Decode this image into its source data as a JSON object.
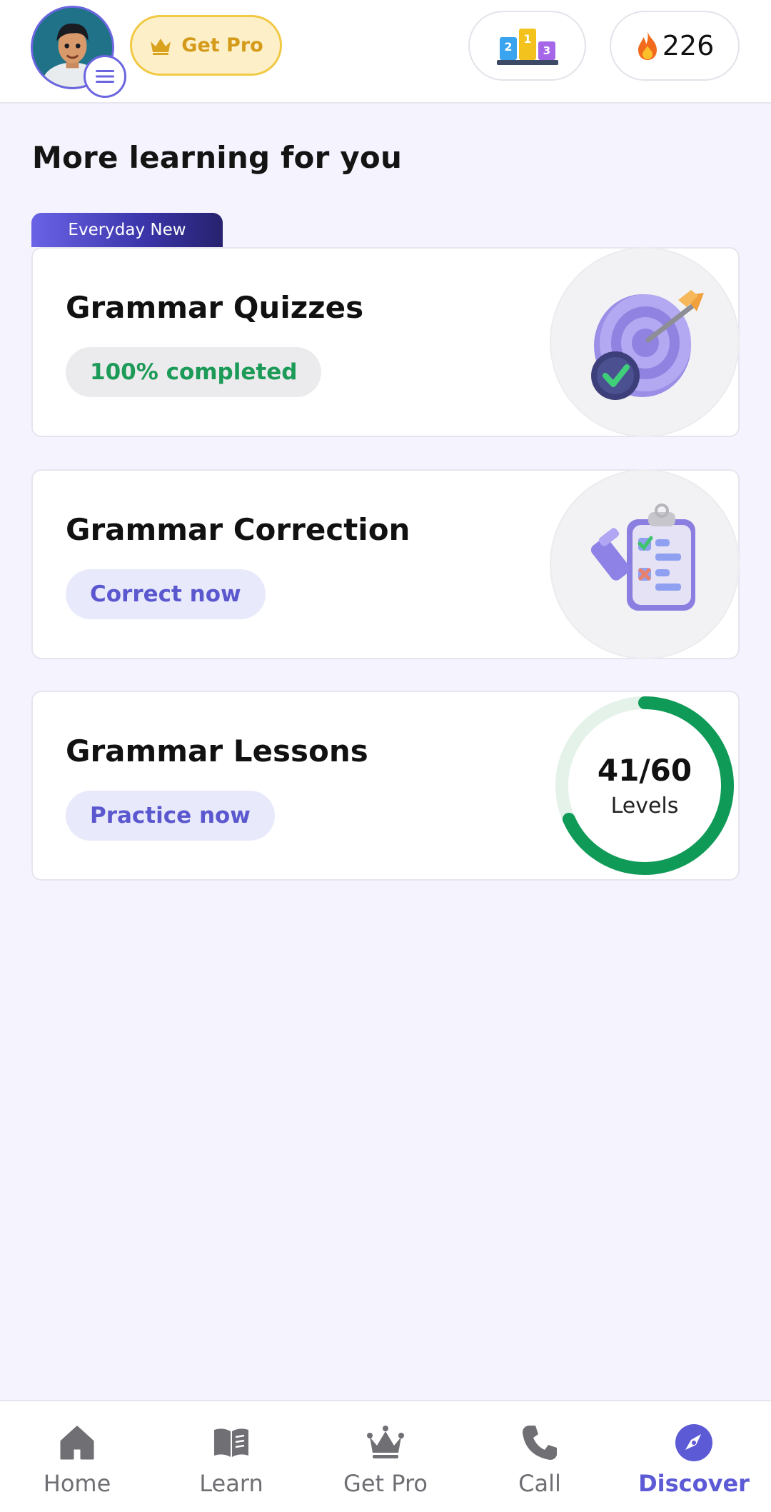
{
  "header": {
    "get_pro_label": "Get Pro",
    "streak_count": "226",
    "leaderboard_ranks": [
      "2",
      "1",
      "3"
    ]
  },
  "section": {
    "title": "More learning for you"
  },
  "cards": [
    {
      "tag": "Everyday New",
      "title": "Grammar Quizzes",
      "pill": "100% completed",
      "icon": "target-arrow-icon"
    },
    {
      "title": "Grammar Correction",
      "pill": "Correct now",
      "icon": "clipboard-check-icon"
    },
    {
      "title": "Grammar Lessons",
      "pill": "Practice now",
      "progress": {
        "value": "41/60",
        "label": "Levels",
        "completed": 41,
        "total": 60
      }
    }
  ],
  "nav": [
    {
      "label": "Home",
      "icon": "home-icon"
    },
    {
      "label": "Learn",
      "icon": "book-icon"
    },
    {
      "label": "Get Pro",
      "icon": "crown-icon"
    },
    {
      "label": "Call",
      "icon": "phone-icon"
    },
    {
      "label": "Discover",
      "icon": "compass-icon",
      "active": true
    }
  ],
  "colors": {
    "accent": "#5d5ad6",
    "progress_green": "#0f9a57",
    "gold": "#f1c944",
    "background": "#f5f3fd"
  }
}
